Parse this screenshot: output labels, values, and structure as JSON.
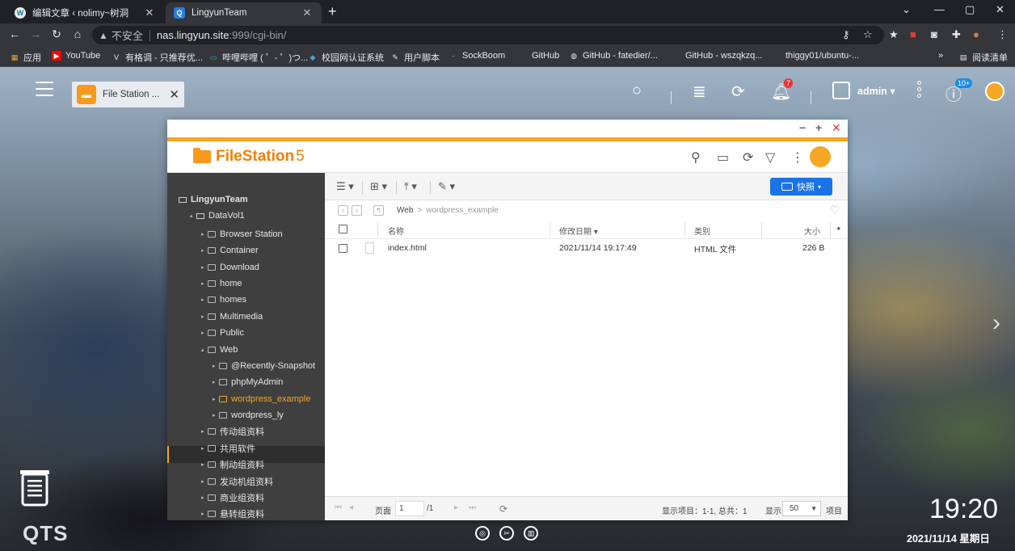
{
  "browser": {
    "tabs": [
      {
        "title": "编辑文章 ‹ nolimy~树洞",
        "favicon": "wordpress-icon",
        "active": false
      },
      {
        "title": "LingyunTeam",
        "favicon": "qnap-icon",
        "active": true
      }
    ],
    "address": {
      "security_label": "不安全",
      "host": "nas.lingyun.site",
      "path": ":999/cgi-bin/"
    },
    "bookmarks": [
      {
        "label": "应用",
        "icon": "apps-icon"
      },
      {
        "label": "YouTube",
        "icon": "youtube-icon"
      },
      {
        "label": "有格调 - 只推荐优...",
        "icon": "v-icon"
      },
      {
        "label": "哔哩哔哩 ( ゜- ゜)つ...",
        "icon": "bilibili-icon"
      },
      {
        "label": "校园网认证系统",
        "icon": "diamond-icon"
      },
      {
        "label": "用户脚本",
        "icon": "script-icon"
      },
      {
        "label": "SockBoom",
        "icon": "sock-icon"
      },
      {
        "label": "GitHub",
        "icon": "github-icon"
      },
      {
        "label": "GitHub - fatedier/...",
        "icon": "github-icon"
      },
      {
        "label": "GitHub - wszqkzq...",
        "icon": "github-icon"
      },
      {
        "label": "thiggy01/ubuntu-...",
        "icon": "github-icon"
      }
    ],
    "bookmarks_more": "»",
    "reading_list": "阅读清单"
  },
  "qts": {
    "app_tab_label": "File Station ...",
    "user": "admin",
    "notification_count": "7",
    "info_count": "10+",
    "clock_time": "19:20",
    "clock_date": "2021/11/14 星期日",
    "logo": "QTS"
  },
  "filestation": {
    "logo_name": "FileStation",
    "logo_version": "5",
    "snapshot_label": "快照",
    "breadcrumb": [
      "Web",
      "wordpress_example"
    ],
    "tree": [
      {
        "label": "LingyunTeam",
        "level": 0,
        "type": "root"
      },
      {
        "label": "DataVol1",
        "level": 1,
        "type": "drive"
      },
      {
        "label": "Browser Station",
        "level": 2,
        "type": "folder"
      },
      {
        "label": "Container",
        "level": 2,
        "type": "folder"
      },
      {
        "label": "Download",
        "level": 2,
        "type": "folder"
      },
      {
        "label": "home",
        "level": 2,
        "type": "folder"
      },
      {
        "label": "homes",
        "level": 2,
        "type": "folder"
      },
      {
        "label": "Multimedia",
        "level": 2,
        "type": "folder"
      },
      {
        "label": "Public",
        "level": 2,
        "type": "folder"
      },
      {
        "label": "Web",
        "level": 2,
        "type": "folder",
        "expanded": true
      },
      {
        "label": "@Recently-Snapshot",
        "level": 3,
        "type": "folder"
      },
      {
        "label": "phpMyAdmin",
        "level": 3,
        "type": "folder"
      },
      {
        "label": "wordpress_example",
        "level": 3,
        "type": "folder",
        "selected": true
      },
      {
        "label": "wordpress_ly",
        "level": 3,
        "type": "folder"
      },
      {
        "label": "传动组资料",
        "level": 2,
        "type": "folder"
      },
      {
        "label": "共用软件",
        "level": 2,
        "type": "folder"
      },
      {
        "label": "制动组资料",
        "level": 2,
        "type": "folder"
      },
      {
        "label": "发动机组资料",
        "level": 2,
        "type": "folder"
      },
      {
        "label": "商业组资料",
        "level": 2,
        "type": "folder"
      },
      {
        "label": "悬转组资料",
        "level": 2,
        "type": "folder"
      }
    ],
    "columns": {
      "name": "名称",
      "modified": "修改日期",
      "type": "类别",
      "size": "大小"
    },
    "files": [
      {
        "name": "index.html",
        "modified": "2021/11/14 19:17:49",
        "type": "HTML 文件",
        "size": "226 B"
      }
    ],
    "status": {
      "page_label": "页面",
      "page_value": "1",
      "page_total": "/1",
      "items_text": "显示项目：1-1, 总共：1",
      "show_label": "显示",
      "per_page": "50",
      "items_label": "项目"
    }
  },
  "colors": {
    "accent_orange": "#f5a623",
    "snapshot_blue": "#1a73e8",
    "sidebar_bg": "#3f3f3f"
  }
}
